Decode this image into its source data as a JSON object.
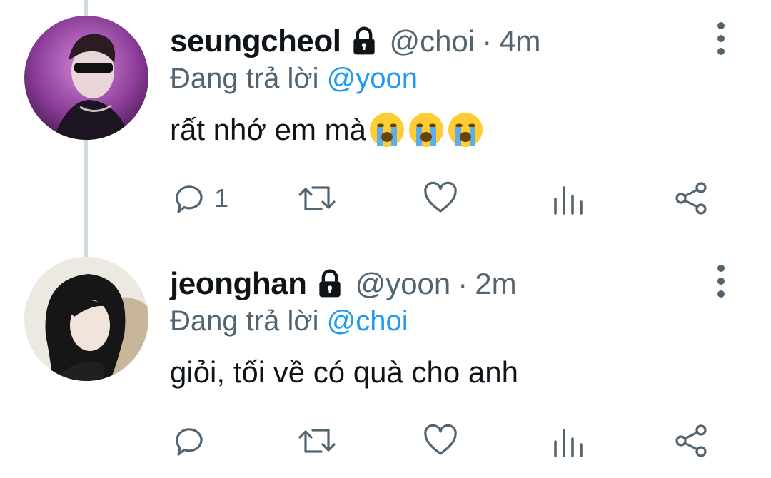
{
  "tweets": [
    {
      "name": "seungcheol",
      "handle": "@choi",
      "dot": "·",
      "time": "4m",
      "reply_prefix": "Đang trả lời ",
      "reply_mention": "@yoon",
      "text": "rất nhớ em mà",
      "emojis": [
        "loudly-crying-face-icon",
        "loudly-crying-face-icon",
        "loudly-crying-face-icon"
      ],
      "reply_count": "1",
      "avatar_colors": [
        "#7a2a8a",
        "#c060c8"
      ]
    },
    {
      "name": "jeonghan",
      "handle": "@yoon",
      "dot": "·",
      "time": "2m",
      "reply_prefix": "Đang trả lời ",
      "reply_mention": "@choi",
      "text": "giỏi, tối về có quà cho anh",
      "reply_count": "",
      "avatar_colors": [
        "#e6e2dc",
        "#1a1a1a"
      ]
    }
  ],
  "colors": {
    "icon": "#536471",
    "mention": "#1d9bf0",
    "thread_line": "#cfd9de"
  }
}
